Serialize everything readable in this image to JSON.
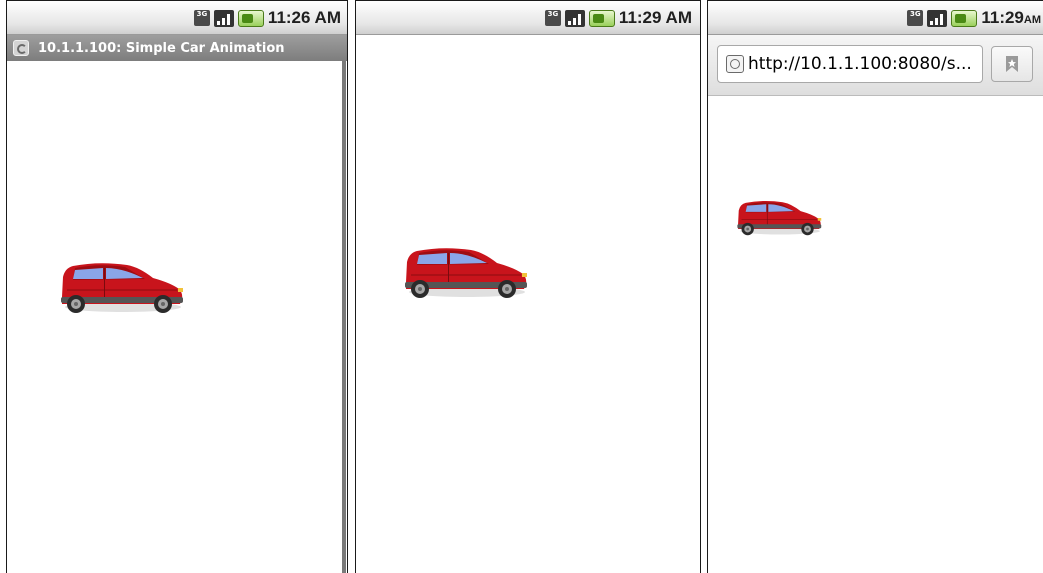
{
  "screens": [
    {
      "status_time": "11:26 AM",
      "network_label": "3G",
      "title_bar": {
        "text": "10.1.1.100: Simple Car Animation"
      }
    },
    {
      "status_time": "11:29 AM",
      "network_label": "3G"
    },
    {
      "status_time": "11:29",
      "status_time_suffix": "AM",
      "network_label": "3G",
      "url_bar": {
        "url": "http://10.1.1.100:8080/s..."
      }
    }
  ],
  "icons": {
    "network": "network-3g-icon",
    "signal": "signal-strength-icon",
    "battery": "battery-icon",
    "browser": "globe-icon",
    "bookmark": "bookmark-icon",
    "car": "red-car-image"
  },
  "colors": {
    "car_body": "#c8141c",
    "car_window": "#8aa6e8",
    "title_bar": "#888888",
    "battery": "#6ab22a"
  }
}
